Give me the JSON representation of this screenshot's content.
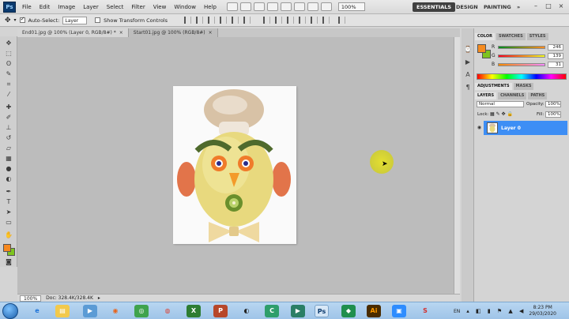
{
  "menubar": {
    "app_logo": "Ps",
    "items": [
      "File",
      "Edit",
      "Image",
      "Layer",
      "Select",
      "Filter",
      "View",
      "Window",
      "Help"
    ],
    "zoom": "100%",
    "workspaces": [
      "ESSENTIALS",
      "DESIGN",
      "PAINTING"
    ],
    "workspace_more": "»",
    "window_controls": [
      "–",
      "□",
      "×"
    ]
  },
  "options": {
    "auto_select_label": "Auto-Select:",
    "auto_select_value": "Layer",
    "transform_label": "Show Transform Controls"
  },
  "tabs": [
    {
      "label": "End01.jpg @ 100% (Layer 0, RGB/8#) *",
      "close": "×"
    },
    {
      "label": "Start01.jpg @ 100% (RGB/8#)",
      "close": "×"
    }
  ],
  "status": {
    "zoom": "100%",
    "doc": "Doc: 328.4K/328.4K"
  },
  "color_panel": {
    "tabs": [
      "COLOR",
      "SWATCHES",
      "STYLES"
    ],
    "channels": [
      {
        "label": "R",
        "value": "246"
      },
      {
        "label": "G",
        "value": "139"
      },
      {
        "label": "B",
        "value": "31"
      }
    ],
    "foreground": "#f68b1f",
    "background": "#7ec41f"
  },
  "adjustments_panel": {
    "tabs": [
      "ADJUSTMENTS",
      "MASKS"
    ]
  },
  "layers_panel": {
    "tabs": [
      "LAYERS",
      "CHANNELS",
      "PATHS"
    ],
    "blend_mode": "Normal",
    "opacity_label": "Opacity:",
    "opacity_value": "100%",
    "lock_label": "Lock:",
    "fill_label": "Fill:",
    "fill_value": "100%",
    "layer_name": "Layer 0"
  },
  "taskbar": {
    "time": "8:23 PM",
    "date": "29/03/2020",
    "language": "EN"
  },
  "colors": {
    "accent": "#3d8ef5",
    "taskbar": "#a9cbeb"
  }
}
